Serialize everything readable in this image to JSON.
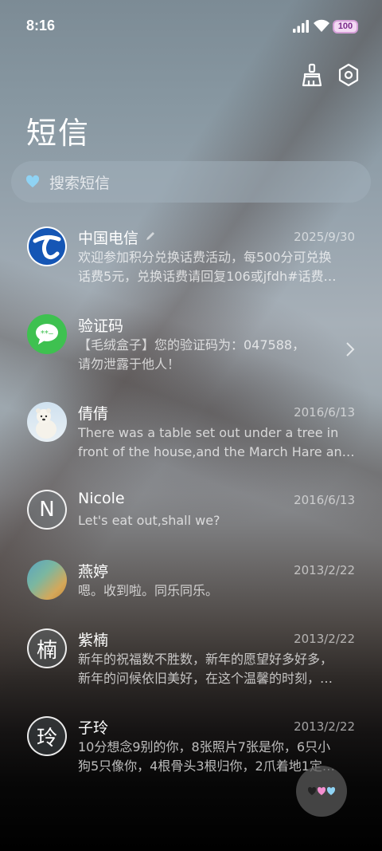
{
  "status": {
    "time": "8:16",
    "battery": "100"
  },
  "header": {
    "title": "短信",
    "icons": [
      "broom-icon",
      "settings-icon"
    ]
  },
  "search": {
    "placeholder": "搜索短信"
  },
  "conversations": [
    {
      "name": "中国电信",
      "date": "2025/9/30",
      "line1": "欢迎参加积分兑换话费活动，每500分可兑换",
      "line2": "话费5元，兑换话费请回复106或jfdh#话费…"
    },
    {
      "name": "验证码",
      "date": "",
      "line1": "【毛绒盒子】您的验证码为：047588，",
      "line2": "请勿泄露于他人！"
    },
    {
      "name": "倩倩",
      "date": "2016/6/13",
      "line1": "There was a table set out under a tree in",
      "line2": "front of the house,and the March Hare an…"
    },
    {
      "name": "Nicole",
      "date": "2016/6/13",
      "avatar_letter": "N",
      "line1": "Let's eat out,shall we?",
      "line2": ""
    },
    {
      "name": "燕婷",
      "date": "2013/2/22",
      "line1": "嗯。收到啦。同乐同乐。",
      "line2": ""
    },
    {
      "name": "紫楠",
      "date": "2013/2/22",
      "avatar_letter": "楠",
      "line1": "新年的祝福数不胜数，新年的愿望好多好多，",
      "line2": "新年的问候依旧美好，在这个温馨的时刻，…"
    },
    {
      "name": "子玲",
      "date": "2013/2/22",
      "avatar_letter": "玲",
      "line1": "10分想念9别的你，8张照片7张是你，6只小",
      "line2": "狗5只像你，4根骨头3根归你，2爪着地1定…"
    }
  ],
  "fab": {
    "icon": "hearts-icon"
  },
  "colors": {
    "heart_blue": "#8fd3f4",
    "heart_pink": "#f38fd0",
    "wechat_green": "#3ec150",
    "telecom_blue": "#1556b5"
  }
}
